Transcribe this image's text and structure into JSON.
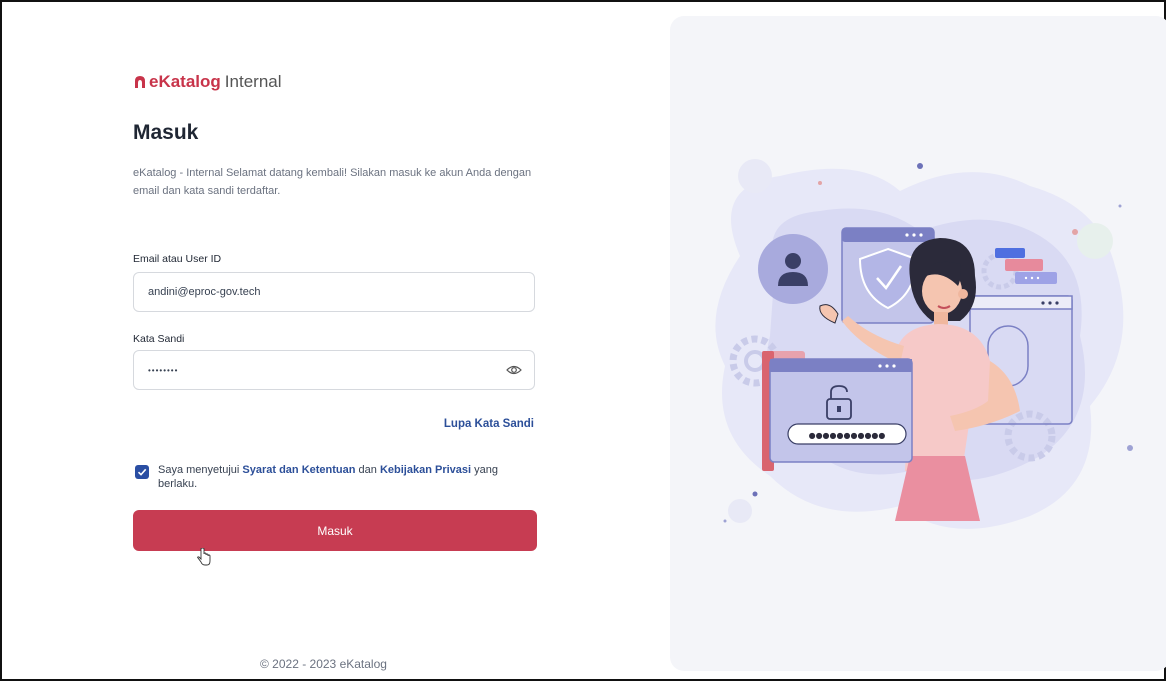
{
  "brand": {
    "name": "eKatalog",
    "sub": "Internal"
  },
  "login": {
    "title": "Masuk",
    "description": "eKatalog - Internal Selamat datang kembali! Silakan masuk ke akun Anda dengan email dan kata sandi terdaftar.",
    "email_label": "Email atau User ID",
    "email_value": "andini@eproc-gov.tech",
    "password_label": "Kata Sandi",
    "password_value": "••••••••",
    "forgot_label": "Lupa Kata Sandi",
    "agree_prefix": "Saya menyetujui",
    "terms_link": "Syarat dan Ketentuan",
    "agree_mid": "dan",
    "privacy_link": "Kebijakan Privasi",
    "agree_suffix": "yang berlaku.",
    "agree_checked": true,
    "submit_label": "Masuk"
  },
  "illustration": {
    "password_dots": "●●●●●●●●●●●"
  },
  "footer": {
    "copyright": "© 2022 - 2023 eKatalog"
  },
  "colors": {
    "primary": "#c73c52",
    "link": "#2c4f99",
    "panel": "#f4f5f9"
  }
}
